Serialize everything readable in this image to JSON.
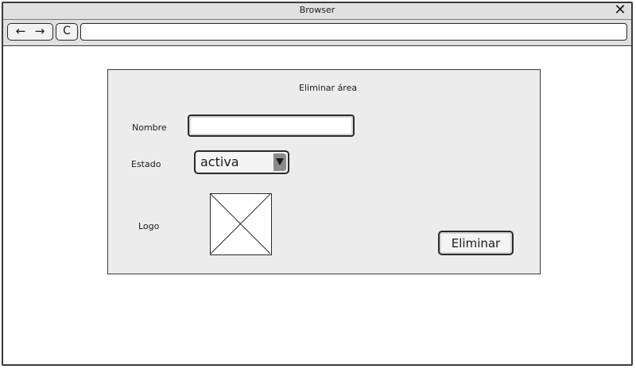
{
  "window": {
    "title": "Browser",
    "close_icon": "close-icon"
  },
  "toolbar": {
    "back_glyph": "←",
    "forward_glyph": "→",
    "reload_glyph": "C",
    "address_value": ""
  },
  "form": {
    "title": "Eliminar área",
    "name_label": "Nombre",
    "name_value": "",
    "status_label": "Estado",
    "status_value": "activa",
    "logo_label": "Logo",
    "delete_label": "Eliminar"
  },
  "colors": {
    "chrome": "#e0e0e0",
    "panel": "#ececec",
    "border": "#2a2a2a"
  }
}
